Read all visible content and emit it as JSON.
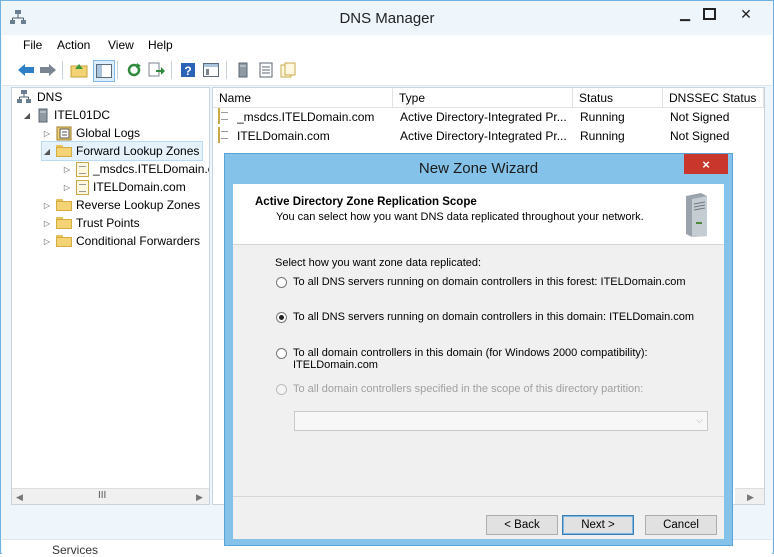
{
  "window": {
    "title": "DNS Manager",
    "controls": {
      "minimize": "minimize-icon",
      "maximize": "maximize-icon",
      "close": "close-icon"
    }
  },
  "menu": [
    "File",
    "Action",
    "View",
    "Help"
  ],
  "toolbar": [
    "back-icon",
    "forward-icon",
    "up-folder-icon",
    "show-hide-tree-icon",
    "refresh-icon",
    "export-icon",
    "help-icon",
    "properties-icon",
    "server-icon",
    "list-icon",
    "zone-icon"
  ],
  "tree": {
    "root": "DNS",
    "server": "ITEL01DC",
    "items": [
      "Global Logs",
      "Forward Lookup Zones",
      "_msdcs.ITELDomain.c",
      "ITELDomain.com",
      "Reverse Lookup Zones",
      "Trust Points",
      "Conditional Forwarders"
    ],
    "scroll_thumb": "III"
  },
  "list": {
    "columns": [
      "Name",
      "Type",
      "Status",
      "DNSSEC Status"
    ],
    "rows": [
      [
        "_msdcs.ITELDomain.com",
        "Active Directory-Integrated Pr...",
        "Running",
        "Not Signed"
      ],
      [
        "ITELDomain.com",
        "Active Directory-Integrated Pr...",
        "Running",
        "Not Signed"
      ]
    ]
  },
  "bottom": {
    "text": "Services"
  },
  "wizard": {
    "title": "New Zone Wizard",
    "close": "×",
    "heading": "Active Directory Zone Replication Scope",
    "subheading": "You can select how you want DNS data replicated throughout your network.",
    "prompt": "Select how you want zone data replicated:",
    "options": [
      {
        "label": "To all DNS servers running on domain controllers in this forest: ITELDomain.com",
        "checked": false,
        "enabled": true
      },
      {
        "label": "To all DNS servers running on domain controllers in this domain: ITELDomain.com",
        "checked": true,
        "enabled": true
      },
      {
        "label": "To all domain controllers in this domain (for Windows 2000 compatibility):",
        "label2": "ITELDomain.com",
        "checked": false,
        "enabled": true
      },
      {
        "label": "To all domain controllers specified in the scope of this directory partition:",
        "checked": false,
        "enabled": false
      }
    ],
    "combo_value": "",
    "buttons": {
      "back": "< Back",
      "next": "Next >",
      "cancel": "Cancel"
    }
  }
}
